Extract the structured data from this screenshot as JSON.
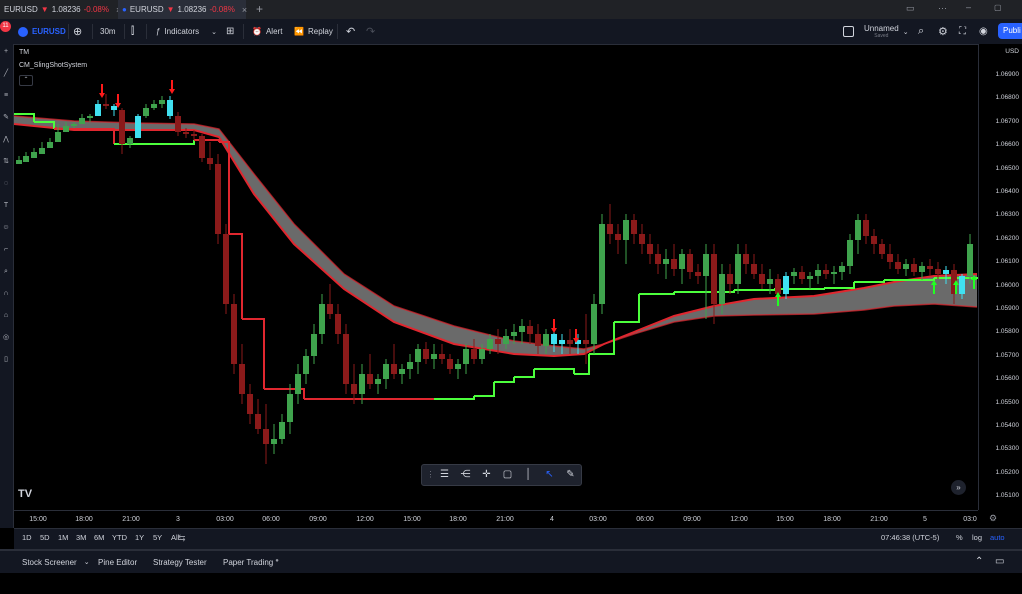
{
  "browser_tabs": [
    {
      "symbol": "EURUSD",
      "arrow": "▼",
      "price": "1.08236",
      "change": "-0.08%"
    },
    {
      "symbol": "EURUSD",
      "arrow": "▼",
      "price": "1.08236",
      "change": "-0.08%"
    }
  ],
  "new_tab_label": "+",
  "notification_count": "11",
  "toolbar": {
    "symbol": "EURUSD",
    "interval": "30m",
    "indicators_label": "Indicators",
    "alert_label": "Alert",
    "replay_label": "Replay",
    "layout_name": "Unnamed",
    "layout_status": "Saved",
    "publish_label": "Publi"
  },
  "chart": {
    "ticker_line": "TM",
    "indicator_name": "CM_SlingShotSystem",
    "currency": "USD",
    "colors": {
      "up": "#26a69a",
      "down": "#ef5350",
      "bull_cloud": "#4cff3c",
      "bear_line": "#e0272f",
      "cloud_fill": "#7d7d7d",
      "highlight": "#40e0f0"
    },
    "price_labels": [
      "1.06900",
      "1.06800",
      "1.06700",
      "1.06600",
      "1.06500",
      "1.06400",
      "1.06300",
      "1.06200",
      "1.06100",
      "1.06000",
      "1.05900",
      "1.05800",
      "1.05700",
      "1.05600",
      "1.05500",
      "1.05400",
      "1.05300",
      "1.05200",
      "1.05100"
    ],
    "time_labels": [
      "15:00",
      "18:00",
      "21:00",
      "3",
      "03:00",
      "06:00",
      "09:00",
      "12:00",
      "15:00",
      "18:00",
      "21:00",
      "4",
      "03:00",
      "06:00",
      "09:00",
      "12:00",
      "15:00",
      "18:00",
      "21:00",
      "5",
      "03:0"
    ]
  },
  "range_bar": {
    "ranges": [
      "1D",
      "5D",
      "1M",
      "3M",
      "6M",
      "YTD",
      "1Y",
      "5Y",
      "All"
    ],
    "clock": "07:46:38 (UTC-5)",
    "percent_label": "%",
    "log_label": "log",
    "auto_label": "auto"
  },
  "panels": [
    "Stock Screener",
    "Pine Editor",
    "Strategy Tester",
    "Paper Trading"
  ]
}
